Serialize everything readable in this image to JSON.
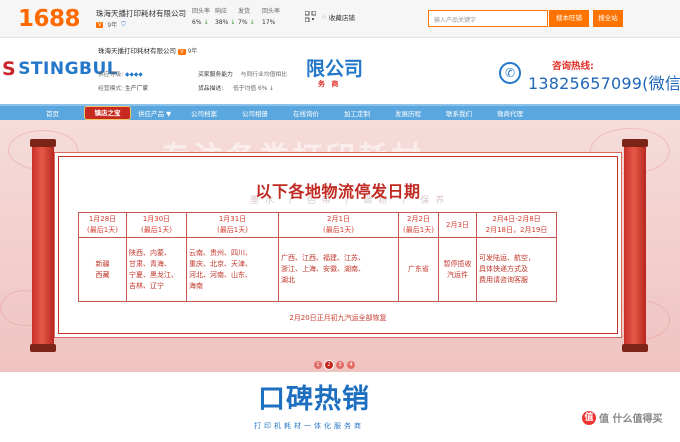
{
  "top_bar": {
    "logo": "1688",
    "company_name": "珠海天播打印耗材有限公司",
    "years_badge": "9年",
    "stats": [
      {
        "label": "回头率",
        "value": "6%",
        "trend": "↓"
      },
      {
        "label": "响应",
        "value": "38%",
        "trend": "↓"
      },
      {
        "label": "发货",
        "value": "7%",
        "trend": "↓"
      },
      {
        "label": "回头率",
        "value": "17%",
        "trend": ""
      }
    ],
    "favorite_label": "收藏店铺",
    "search_placeholder": "输入产品关键字",
    "search_store_button": "搜本旺铺",
    "search_all_button": "搜全站"
  },
  "store_header": {
    "brand_logo": "STINGBUL",
    "company_name": "珠海天播打印耗材有限公司",
    "years": "9年",
    "supplier_level_label": "供应等级:",
    "business_model_label": "经营模式:",
    "business_model": "生产厂家",
    "buyer_service_label": "买家服务能力",
    "buyer_service_value": "与同行业均值相比",
    "repurchase_label": "货品描述:",
    "repurchase_value": "低于均值 6% ↓",
    "title_visible": "限公司",
    "subtitle": "务 商",
    "hotline_label": "咨询热线:",
    "phone": "13825657099(微信"
  },
  "nav": {
    "items": [
      "首页",
      "供应产品 ▼",
      "公司档案",
      "公司相册",
      "在线询价",
      "加工定制",
      "发展历程",
      "联系我们",
      "微商代理"
    ],
    "hot_tag": "镇店之宝"
  },
  "banner": {
    "watermark": "专注各类打印耗材",
    "watermark_sub": "墨水 / 色带 / 碳粉 / 保养",
    "title": "以下各地物流停发日期",
    "columns": [
      {
        "date": "1月28日",
        "note": "(最后1天)",
        "regions": "新疆\n西藏"
      },
      {
        "date": "1月30日",
        "note": "(最后1天)",
        "regions": "陕西、内蒙、\n甘肃、青海、\n宁夏、黑龙江、\n吉林、辽宁"
      },
      {
        "date": "1月31日",
        "note": "(最后1天)",
        "regions": "云南、贵州、四川、\n重庆、北京、天津、\n河北、河南、山东、\n海南"
      },
      {
        "date": "2月1日",
        "note": "(最后1天)",
        "regions": "广西、江西、福建、江苏、\n浙江、上海、安徽、湖南、\n湖北"
      },
      {
        "date": "2月2日",
        "note": "(最后1天)",
        "regions": "广东省"
      },
      {
        "date": "2月3日",
        "note": "",
        "regions": "暂停揽收\n汽运件"
      },
      {
        "date": "2月4日-2月8日",
        "note": "2月18日，2月19日",
        "regions": "可发陆运、航空，\n具体快递方式及\n费用请咨询客服"
      }
    ],
    "footnote": "2月20日正月初九汽运全部恢复",
    "slides": [
      "1",
      "2",
      "3",
      "4"
    ],
    "active_slide": 2
  },
  "section": {
    "title": "口碑热销",
    "subtitle": "打印机耗材一体化服务商"
  },
  "watermark_corner": "值 什么值得买"
}
